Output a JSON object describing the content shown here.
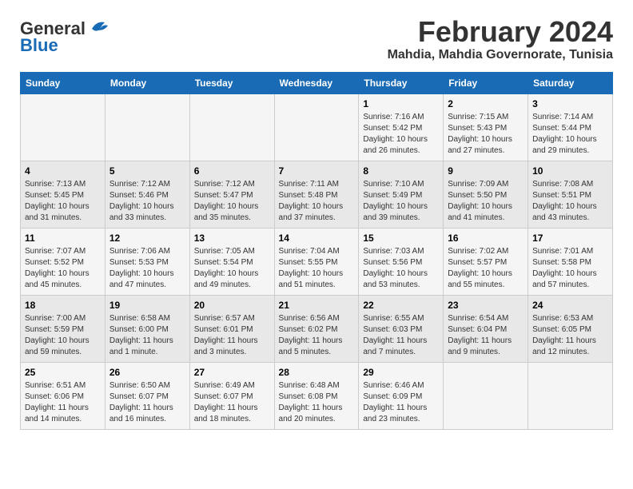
{
  "logo": {
    "line1": "General",
    "line2": "Blue"
  },
  "title": "February 2024",
  "subtitle": "Mahdia, Mahdia Governorate, Tunisia",
  "days_header": [
    "Sunday",
    "Monday",
    "Tuesday",
    "Wednesday",
    "Thursday",
    "Friday",
    "Saturday"
  ],
  "weeks": [
    [
      {
        "day": "",
        "info": ""
      },
      {
        "day": "",
        "info": ""
      },
      {
        "day": "",
        "info": ""
      },
      {
        "day": "",
        "info": ""
      },
      {
        "day": "1",
        "info": "Sunrise: 7:16 AM\nSunset: 5:42 PM\nDaylight: 10 hours\nand 26 minutes."
      },
      {
        "day": "2",
        "info": "Sunrise: 7:15 AM\nSunset: 5:43 PM\nDaylight: 10 hours\nand 27 minutes."
      },
      {
        "day": "3",
        "info": "Sunrise: 7:14 AM\nSunset: 5:44 PM\nDaylight: 10 hours\nand 29 minutes."
      }
    ],
    [
      {
        "day": "4",
        "info": "Sunrise: 7:13 AM\nSunset: 5:45 PM\nDaylight: 10 hours\nand 31 minutes."
      },
      {
        "day": "5",
        "info": "Sunrise: 7:12 AM\nSunset: 5:46 PM\nDaylight: 10 hours\nand 33 minutes."
      },
      {
        "day": "6",
        "info": "Sunrise: 7:12 AM\nSunset: 5:47 PM\nDaylight: 10 hours\nand 35 minutes."
      },
      {
        "day": "7",
        "info": "Sunrise: 7:11 AM\nSunset: 5:48 PM\nDaylight: 10 hours\nand 37 minutes."
      },
      {
        "day": "8",
        "info": "Sunrise: 7:10 AM\nSunset: 5:49 PM\nDaylight: 10 hours\nand 39 minutes."
      },
      {
        "day": "9",
        "info": "Sunrise: 7:09 AM\nSunset: 5:50 PM\nDaylight: 10 hours\nand 41 minutes."
      },
      {
        "day": "10",
        "info": "Sunrise: 7:08 AM\nSunset: 5:51 PM\nDaylight: 10 hours\nand 43 minutes."
      }
    ],
    [
      {
        "day": "11",
        "info": "Sunrise: 7:07 AM\nSunset: 5:52 PM\nDaylight: 10 hours\nand 45 minutes."
      },
      {
        "day": "12",
        "info": "Sunrise: 7:06 AM\nSunset: 5:53 PM\nDaylight: 10 hours\nand 47 minutes."
      },
      {
        "day": "13",
        "info": "Sunrise: 7:05 AM\nSunset: 5:54 PM\nDaylight: 10 hours\nand 49 minutes."
      },
      {
        "day": "14",
        "info": "Sunrise: 7:04 AM\nSunset: 5:55 PM\nDaylight: 10 hours\nand 51 minutes."
      },
      {
        "day": "15",
        "info": "Sunrise: 7:03 AM\nSunset: 5:56 PM\nDaylight: 10 hours\nand 53 minutes."
      },
      {
        "day": "16",
        "info": "Sunrise: 7:02 AM\nSunset: 5:57 PM\nDaylight: 10 hours\nand 55 minutes."
      },
      {
        "day": "17",
        "info": "Sunrise: 7:01 AM\nSunset: 5:58 PM\nDaylight: 10 hours\nand 57 minutes."
      }
    ],
    [
      {
        "day": "18",
        "info": "Sunrise: 7:00 AM\nSunset: 5:59 PM\nDaylight: 10 hours\nand 59 minutes."
      },
      {
        "day": "19",
        "info": "Sunrise: 6:58 AM\nSunset: 6:00 PM\nDaylight: 11 hours\nand 1 minute."
      },
      {
        "day": "20",
        "info": "Sunrise: 6:57 AM\nSunset: 6:01 PM\nDaylight: 11 hours\nand 3 minutes."
      },
      {
        "day": "21",
        "info": "Sunrise: 6:56 AM\nSunset: 6:02 PM\nDaylight: 11 hours\nand 5 minutes."
      },
      {
        "day": "22",
        "info": "Sunrise: 6:55 AM\nSunset: 6:03 PM\nDaylight: 11 hours\nand 7 minutes."
      },
      {
        "day": "23",
        "info": "Sunrise: 6:54 AM\nSunset: 6:04 PM\nDaylight: 11 hours\nand 9 minutes."
      },
      {
        "day": "24",
        "info": "Sunrise: 6:53 AM\nSunset: 6:05 PM\nDaylight: 11 hours\nand 12 minutes."
      }
    ],
    [
      {
        "day": "25",
        "info": "Sunrise: 6:51 AM\nSunset: 6:06 PM\nDaylight: 11 hours\nand 14 minutes."
      },
      {
        "day": "26",
        "info": "Sunrise: 6:50 AM\nSunset: 6:07 PM\nDaylight: 11 hours\nand 16 minutes."
      },
      {
        "day": "27",
        "info": "Sunrise: 6:49 AM\nSunset: 6:07 PM\nDaylight: 11 hours\nand 18 minutes."
      },
      {
        "day": "28",
        "info": "Sunrise: 6:48 AM\nSunset: 6:08 PM\nDaylight: 11 hours\nand 20 minutes."
      },
      {
        "day": "29",
        "info": "Sunrise: 6:46 AM\nSunset: 6:09 PM\nDaylight: 11 hours\nand 23 minutes."
      },
      {
        "day": "",
        "info": ""
      },
      {
        "day": "",
        "info": ""
      }
    ]
  ]
}
